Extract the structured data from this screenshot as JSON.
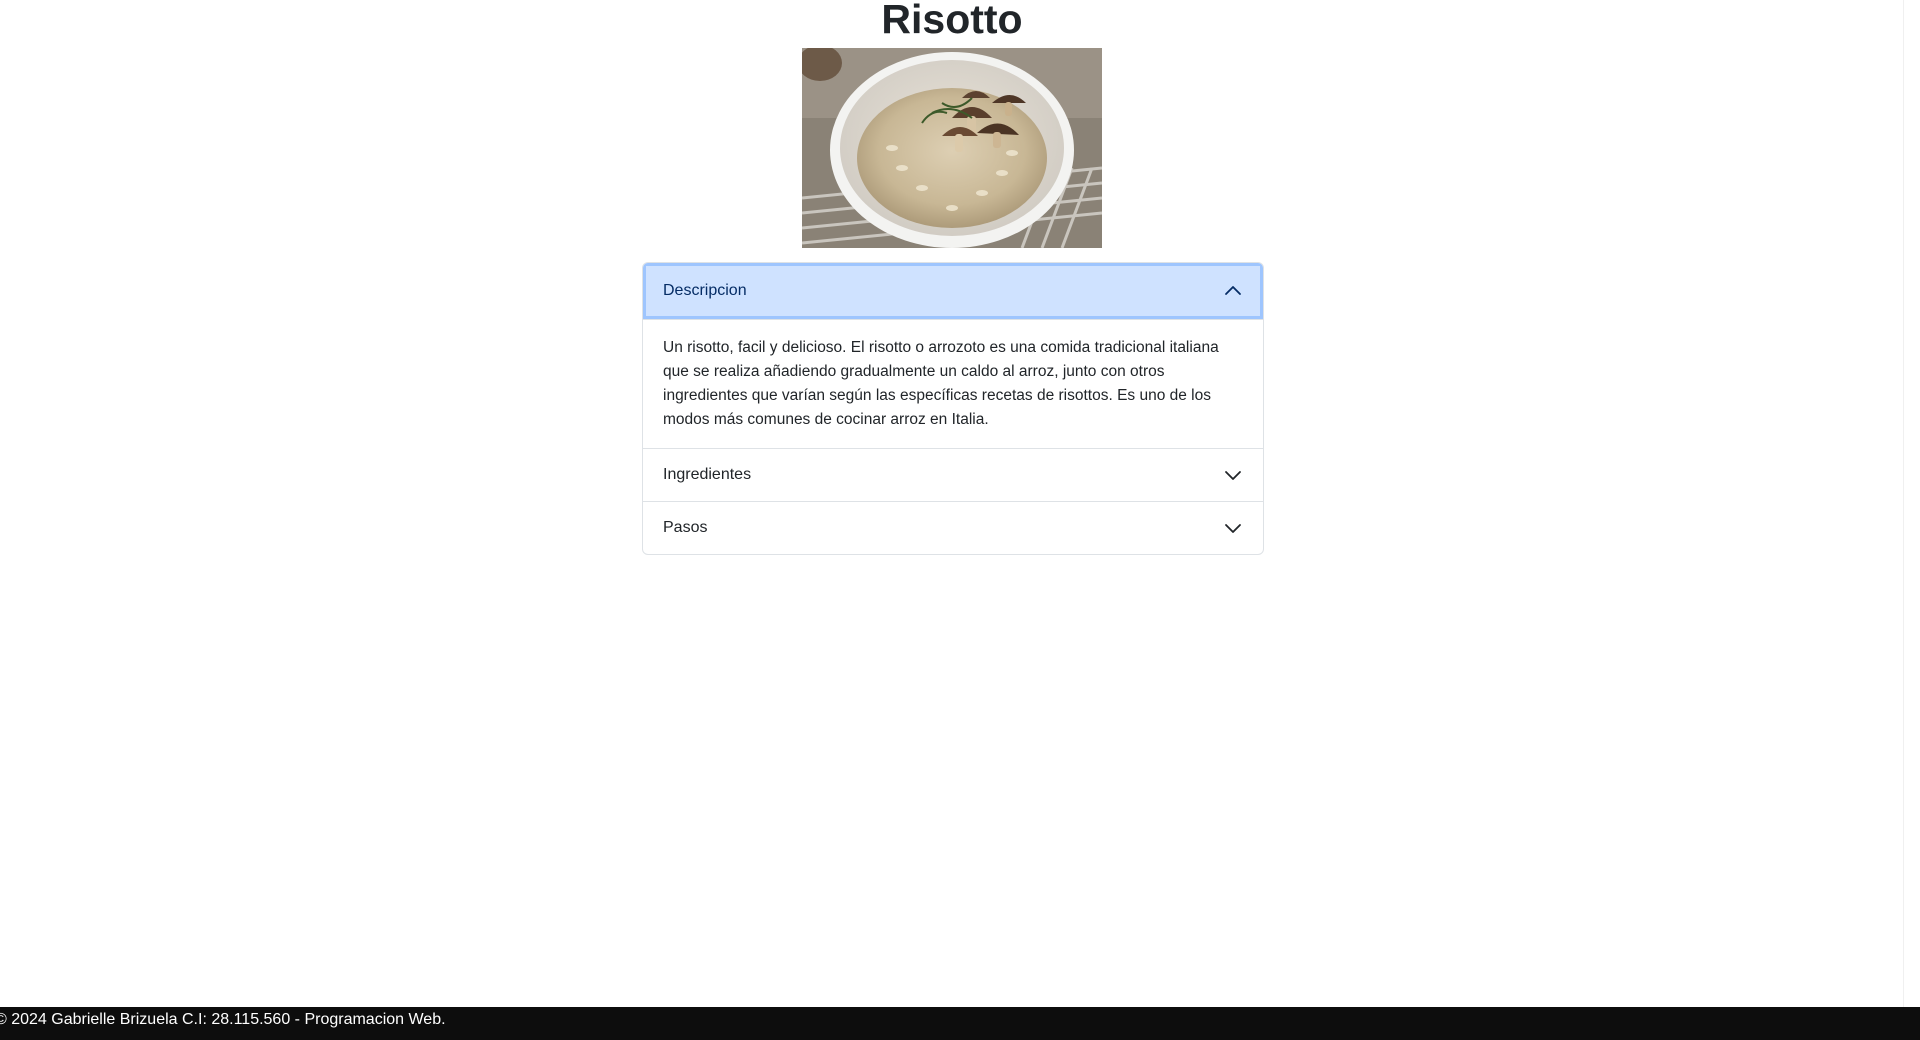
{
  "page": {
    "title": "Risotto"
  },
  "image": {
    "alt": "Risotto"
  },
  "accordion": {
    "items": [
      {
        "label": "Descripcion",
        "open": true,
        "body": "Un risotto, facil y delicioso. El risotto o arrozoto es una comida tradicional italiana que se realiza añadiendo gradualmente un caldo al arroz, junto con otros ingredientes que varían según las específicas recetas de risottos. Es uno de los modos más comunes de cocinar arroz en Italia."
      },
      {
        "label": "Ingredientes",
        "open": false
      },
      {
        "label": "Pasos",
        "open": false
      }
    ]
  },
  "footer": {
    "text": "© 2024 Gabrielle Brizuela C.I: 28.115.560 - Programacion Web."
  },
  "colors": {
    "accordion_active_bg": "#cfe2ff",
    "accordion_active_text": "#052c65",
    "footer_bg": "#0d0d0d"
  }
}
